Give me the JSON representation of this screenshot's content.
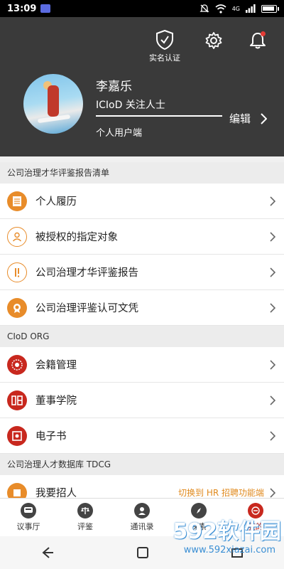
{
  "status_bar": {
    "time": "13:09",
    "network": "4G"
  },
  "header": {
    "verify_label": "实名认证",
    "user_name": "李嘉乐",
    "user_tag": "ICIoD 关注人士",
    "user_type": "个人用户端",
    "edit_label": "编辑"
  },
  "sections": [
    {
      "title": "公司治理才华评鉴报告清单",
      "items": [
        {
          "label": "个人履历",
          "icon": "resume-icon"
        },
        {
          "label": "被授权的指定对象",
          "icon": "authorized-user-icon"
        },
        {
          "label": "公司治理才华评鉴报告",
          "icon": "report-icon"
        },
        {
          "label": "公司治理评鉴认可文凭",
          "icon": "certificate-icon"
        }
      ]
    },
    {
      "title": "CIoD ORG",
      "items": [
        {
          "label": "会籍管理",
          "icon": "membership-icon"
        },
        {
          "label": "董事学院",
          "icon": "academy-icon"
        },
        {
          "label": "电子书",
          "icon": "ebook-icon"
        }
      ]
    },
    {
      "title": "公司治理人才数据库 TDCG",
      "items": [
        {
          "label": "我要招人",
          "icon": "recruit-icon",
          "side_text": "切换到 HR 招聘功能端"
        }
      ]
    }
  ],
  "bottom_nav": [
    {
      "label": "议事厅",
      "active": false
    },
    {
      "label": "评鉴",
      "active": false
    },
    {
      "label": "通讯录",
      "active": false
    },
    {
      "label": "探索",
      "active": false
    },
    {
      "label": "我的",
      "active": true
    }
  ],
  "watermark": {
    "brand": "592软件园",
    "url": "www.592xiazai.com"
  },
  "colors": {
    "header_bg": "#3a3a3a",
    "accent_orange": "#e88c2a",
    "accent_red": "#c8281e"
  }
}
